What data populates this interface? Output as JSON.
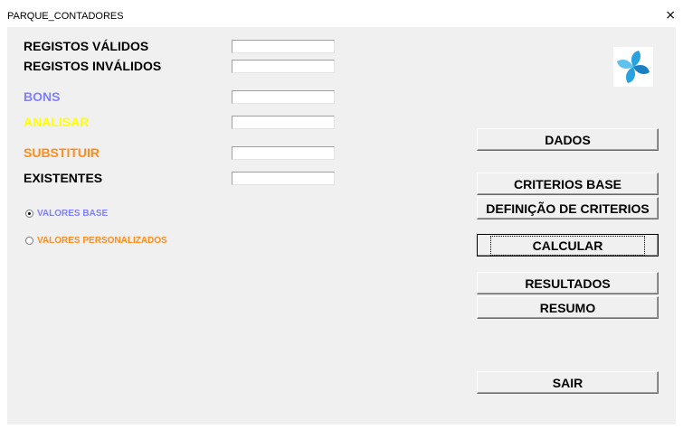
{
  "window": {
    "title": "PARQUE_CONTADORES",
    "close_glyph": "×"
  },
  "labels": {
    "registos_validos": "REGISTOS VÁLIDOS",
    "registos_invalidos": "REGISTOS INVÁLIDOS",
    "bons": "BONS",
    "analisar": "ANALISAR",
    "substituir": "SUBSTITUIR",
    "existentes": "EXISTENTES"
  },
  "fields": {
    "registos_validos": "",
    "registos_invalidos": "",
    "bons": "",
    "analisar": "",
    "substituir": "",
    "existentes": ""
  },
  "options": {
    "valores_base": {
      "label": "VALORES BASE",
      "selected": true
    },
    "valores_personalizados": {
      "label": "VALORES PERSONALIZADOS",
      "selected": false
    }
  },
  "buttons": {
    "dados": "DADOS",
    "criterios_base": "CRITERIOS BASE",
    "definicao_criterios": "DEFINIÇÃO DE CRITERIOS",
    "calcular": "CALCULAR",
    "resultados": "RESULTADOS",
    "resumo": "RESUMO",
    "sair": "SAIR"
  },
  "colors": {
    "bons": "#8080ff",
    "analisar": "#ffff00",
    "substituir": "#ff8c1a",
    "valores_base": "#8080ff",
    "valores_personalizados": "#ff8c1a",
    "logo_blue": "#29a3e0"
  },
  "icons": {
    "logo": "pinwheel-logo-icon"
  }
}
